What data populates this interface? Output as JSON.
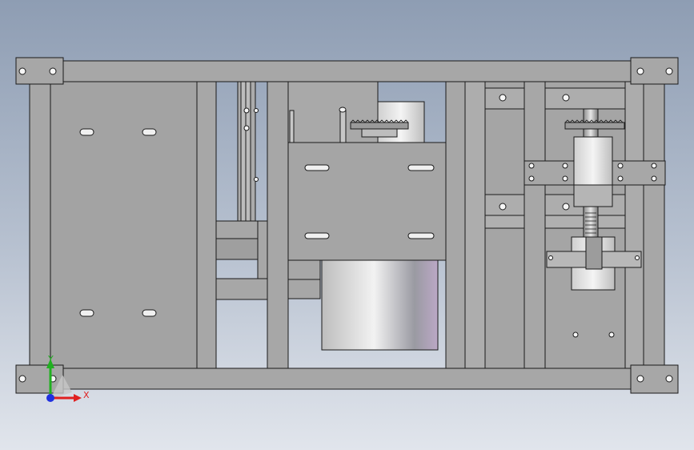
{
  "viewport": {
    "background_top": "#8e9db3",
    "background_bottom": "#e1e5ec"
  },
  "model": {
    "frame_color": "#a7a7a7",
    "edge_color": "#1a1a1a",
    "panel_color": "#a3a3a3",
    "motor_light": "#ececec",
    "motor_dark": "#8a8a92",
    "motor_accent": "#b9a6c4"
  },
  "triad": {
    "x_label": "X",
    "y_label": "Y",
    "x_color": "#e02020",
    "y_color": "#20b020",
    "z_color": "#2030e0"
  }
}
